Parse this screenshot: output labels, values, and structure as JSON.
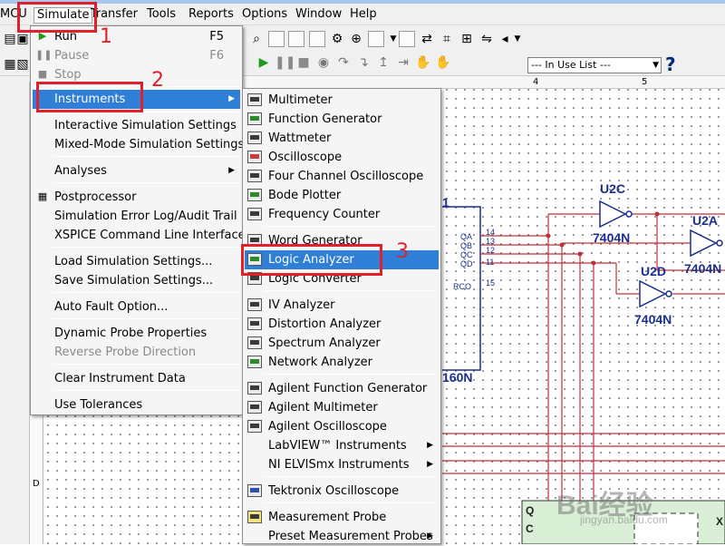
{
  "menubar": {
    "items": [
      "MCU",
      "Simulate",
      "Transfer",
      "Tools",
      "Reports",
      "Options",
      "Window",
      "Help"
    ]
  },
  "toolbar": {
    "in_use_list": "--- In Use List ---",
    "help_icon": "?"
  },
  "ruler": {
    "ticks": [
      "4",
      "5"
    ]
  },
  "annotations": {
    "n1": "1",
    "n2": "2",
    "n3": "3"
  },
  "simulate_menu": {
    "run": "Run",
    "run_shortcut": "F5",
    "pause": "Pause",
    "pause_shortcut": "F6",
    "stop": "Stop",
    "instruments": "Instruments",
    "interactive": "Interactive Simulation Settings",
    "mixed_mode": "Mixed-Mode Simulation Settings",
    "analyses": "Analyses",
    "postprocessor": "Postprocessor",
    "error_log": "Simulation Error Log/Audit Trail",
    "xspice": "XSPICE Command Line Interface",
    "load_settings": "Load Simulation Settings...",
    "save_settings": "Save Simulation Settings...",
    "auto_fault": "Auto Fault Option...",
    "dyn_probe": "Dynamic Probe Properties",
    "reverse_probe": "Reverse Probe Direction",
    "clear_instr": "Clear Instrument Data",
    "use_tol": "Use Tolerances"
  },
  "instruments_menu": {
    "multimeter": "Multimeter",
    "function_generator": "Function Generator",
    "wattmeter": "Wattmeter",
    "oscilloscope": "Oscilloscope",
    "four_channel": "Four Channel Oscilloscope",
    "bode": "Bode Plotter",
    "freq_counter": "Frequency Counter",
    "word_gen": "Word Generator",
    "logic_analyzer": "Logic Analyzer",
    "logic_converter": "Logic Converter",
    "iv_analyzer": "IV Analyzer",
    "distortion": "Distortion Analyzer",
    "spectrum": "Spectrum Analyzer",
    "network": "Network Analyzer",
    "agilent_fg": "Agilent Function Generator",
    "agilent_mm": "Agilent Multimeter",
    "agilent_osc": "Agilent Oscilloscope",
    "labview": "LabVIEW™ Instruments",
    "ni_elvis": "NI ELVISmx Instruments",
    "tektronix": "Tektronix Oscilloscope",
    "meas_probe": "Measurement Probe",
    "preset_probes": "Preset Measurement Probes"
  },
  "schematic": {
    "u2c": "U2C",
    "u2c_part": "7404N",
    "u2a": "U2A",
    "u2a_part": "7404N",
    "u2d": "U2D",
    "u2d_part": "7404N",
    "counter_part": "160N",
    "pin_one": "1",
    "pins": [
      "QA",
      "QB",
      "QC",
      "QD",
      "RCO"
    ],
    "pin_nums": [
      "14",
      "13",
      "12",
      "11",
      "15"
    ],
    "right_char": "X",
    "chip_letters": [
      "Q",
      "C"
    ],
    "left_marker": "D"
  },
  "watermark": {
    "brand": "Bai经验",
    "site": "jingyan.baidu.com"
  }
}
